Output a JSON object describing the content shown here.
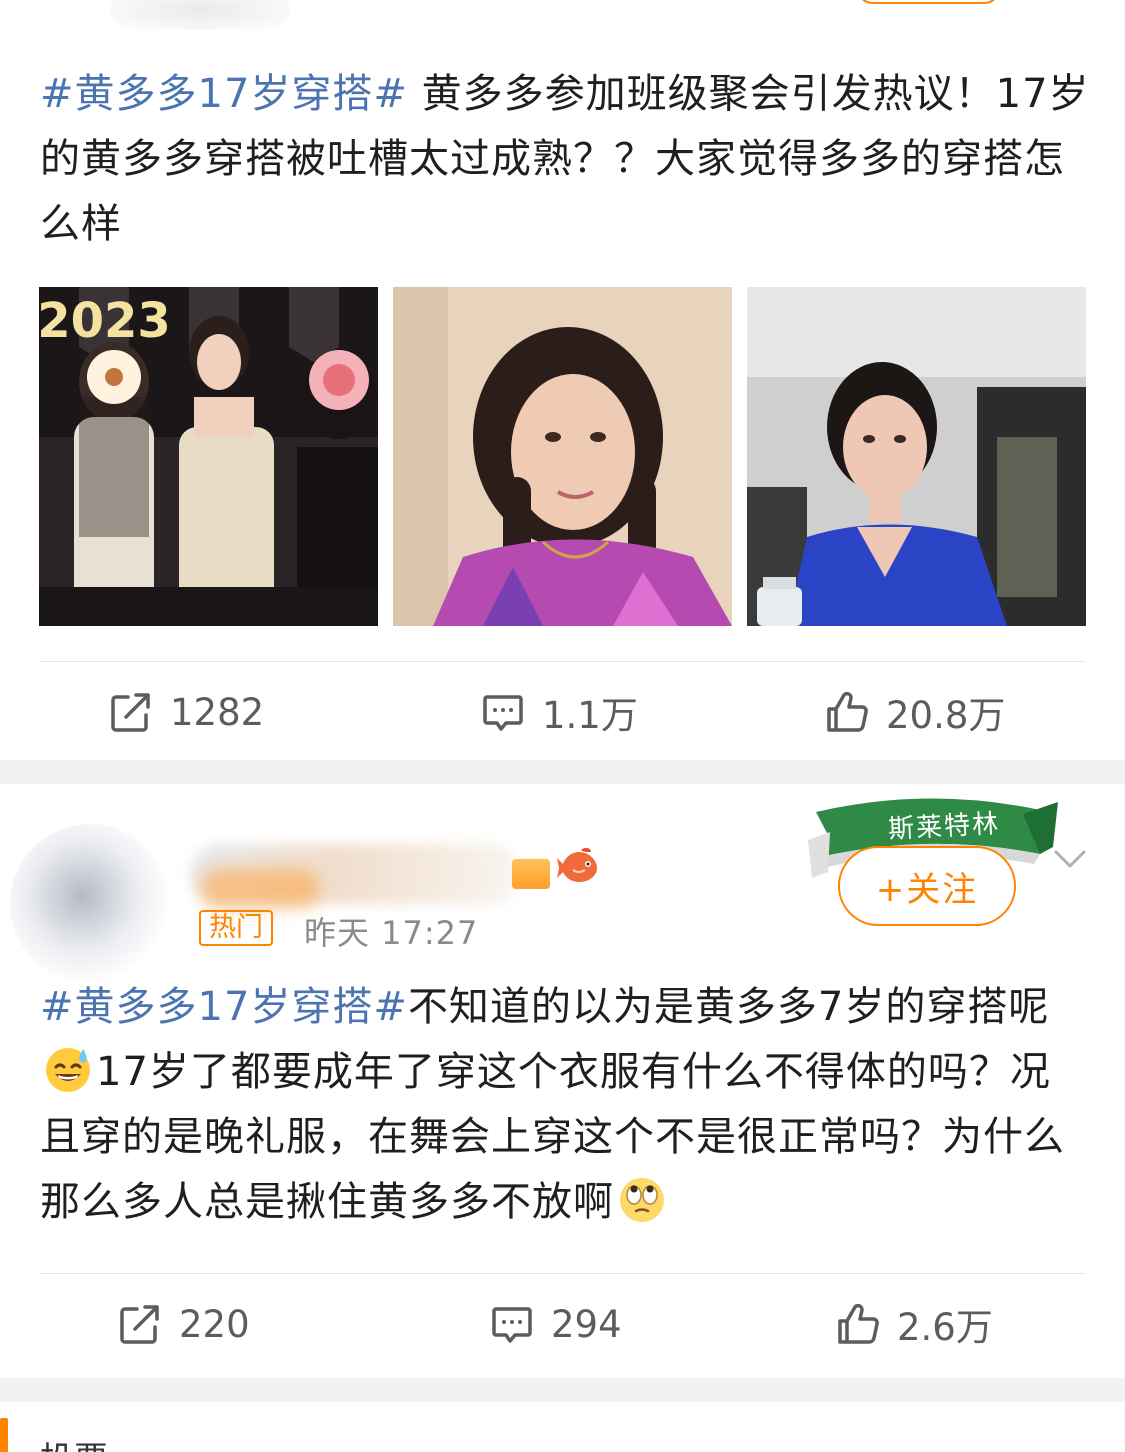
{
  "post1": {
    "hashtag": "#黄多多17岁穿搭#",
    "body": " 黄多多参加班级聚会引发热议！17岁的黄多多穿搭被吐槽太过成熟？？大家觉得多多的穿搭怎么样",
    "photos": [
      {
        "text": "2023"
      },
      {
        "text": ""
      },
      {
        "text": ""
      }
    ],
    "repost_count": "1282",
    "comment_count": "1.1万",
    "like_count": "20.8万"
  },
  "post2": {
    "hot_label": "热门",
    "time": "昨天 17:27",
    "banner_text": "斯莱特林",
    "follow_label": "+关注",
    "hashtag": "#黄多多17岁穿搭#",
    "body_part1": "不知道的以为是黄多多7岁的穿搭呢",
    "body_part2": "17岁了都要成年了穿这个衣服有什么不得体的吗？况且穿的是晚礼服，在舞会上穿这个不是很正常吗？为什么那么多人总是揪住黄多多不放啊",
    "emoji_1": "sweat-smile-emoji",
    "emoji_2": "eye-roll-emoji",
    "repost_count": "220",
    "comment_count": "294",
    "like_count": "2.6万"
  },
  "post3": {
    "title": "投票"
  },
  "icons": {
    "repost": "repost-icon",
    "comment": "comment-icon",
    "like": "like-icon",
    "chevron": "chevron-down-icon",
    "koi": "koi-icon"
  },
  "colors": {
    "hashtag": "#4b74b0",
    "accent": "#ff8200",
    "text": "#1f1f1f",
    "muted": "#5c5c5c",
    "separator": "#f1f1f3",
    "banner_green": "#2e8a45"
  }
}
